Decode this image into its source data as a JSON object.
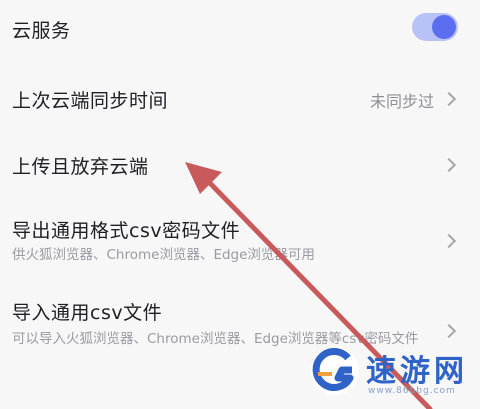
{
  "settings": {
    "cloud_service": {
      "title": "云服务",
      "enabled": true
    },
    "last_sync": {
      "title": "上次云端同步时间",
      "value": "未同步过"
    },
    "upload_abandon": {
      "title": "上传且放弃云端"
    },
    "export_csv": {
      "title": "导出通用格式csv密码文件",
      "desc": "供火狐浏览器、Chrome浏览器、Edge浏览器可用"
    },
    "import_csv": {
      "title": "导入通用csv文件",
      "desc": "可以导入火狐浏览器、Chrome浏览器、Edge浏览器等csv密码文件"
    }
  },
  "watermark": {
    "brand": "速游网",
    "url": "www.86bbg.com"
  },
  "colors": {
    "accent": "#5b6ef0",
    "arrow": "#c95a5c"
  }
}
